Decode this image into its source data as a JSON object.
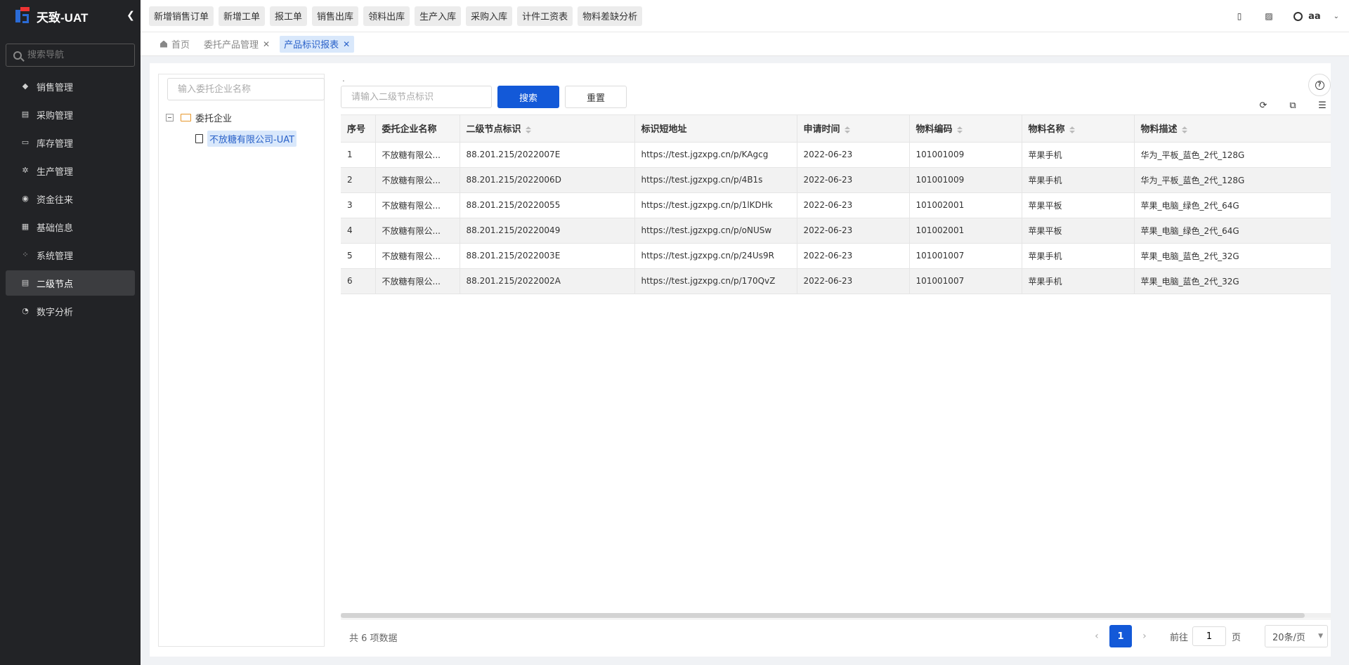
{
  "app": {
    "title": "天致-UAT",
    "collapse_icon": "chevron-left-icon"
  },
  "sidebar": {
    "search_placeholder": "搜索导航",
    "items": [
      {
        "label": "销售管理",
        "icon": "tag-icon",
        "active": false
      },
      {
        "label": "采购管理",
        "icon": "cart-icon",
        "active": false
      },
      {
        "label": "库存管理",
        "icon": "warehouse-icon",
        "active": false
      },
      {
        "label": "生产管理",
        "icon": "production-icon",
        "active": false
      },
      {
        "label": "资金往来",
        "icon": "money-icon",
        "active": false
      },
      {
        "label": "基础信息",
        "icon": "info-grid-icon",
        "active": false
      },
      {
        "label": "系统管理",
        "icon": "apps-icon",
        "active": false
      },
      {
        "label": "二级节点",
        "icon": "node-doc-icon",
        "active": true
      },
      {
        "label": "数字分析",
        "icon": "pie-chart-icon",
        "active": false
      }
    ]
  },
  "topbar": {
    "quick_buttons": [
      "新增销售订单",
      "新增工单",
      "报工单",
      "销售出库",
      "领料出库",
      "生产入库",
      "采购入库",
      "计件工资表",
      "物料差缺分析"
    ],
    "user_name": "aa"
  },
  "tabs": [
    {
      "label": "首页",
      "closable": false,
      "active": false
    },
    {
      "label": "委托产品管理",
      "closable": true,
      "active": false
    },
    {
      "label": "产品标识报表",
      "closable": true,
      "active": true
    }
  ],
  "tree": {
    "search_placeholder": "输入委托企业名称",
    "root_label": "委托企业",
    "child_label": "不放糖有限公司-UAT"
  },
  "filter": {
    "dot": ".",
    "search_placeholder": "请输入二级节点标识",
    "search_label": "搜索",
    "reset_label": "重置"
  },
  "table": {
    "columns": [
      "序号",
      "委托企业名称",
      "二级节点标识",
      "标识短地址",
      "申请时间",
      "物料编码",
      "物料名称",
      "物料描述"
    ],
    "rows": [
      [
        "1",
        "不放糖有限公...",
        "88.201.215/2022007E",
        "https://test.jgzxpg.cn/p/KAgcg",
        "2022-06-23",
        "101001009",
        "苹果手机",
        "华为_平板_蓝色_2代_128G"
      ],
      [
        "2",
        "不放糖有限公...",
        "88.201.215/2022006D",
        "https://test.jgzxpg.cn/p/4B1s",
        "2022-06-23",
        "101001009",
        "苹果手机",
        "华为_平板_蓝色_2代_128G"
      ],
      [
        "3",
        "不放糖有限公...",
        "88.201.215/20220055",
        "https://test.jgzxpg.cn/p/1lKDHk",
        "2022-06-23",
        "101002001",
        "苹果平板",
        "苹果_电脑_绿色_2代_64G"
      ],
      [
        "4",
        "不放糖有限公...",
        "88.201.215/20220049",
        "https://test.jgzxpg.cn/p/oNUSw",
        "2022-06-23",
        "101002001",
        "苹果平板",
        "苹果_电脑_绿色_2代_64G"
      ],
      [
        "5",
        "不放糖有限公...",
        "88.201.215/2022003E",
        "https://test.jgzxpg.cn/p/24Us9R",
        "2022-06-23",
        "101001007",
        "苹果手机",
        "苹果_电脑_蓝色_2代_32G"
      ],
      [
        "6",
        "不放糖有限公...",
        "88.201.215/2022002A",
        "https://test.jgzxpg.cn/p/170QvZ",
        "2022-06-23",
        "101001007",
        "苹果手机",
        "苹果_电脑_蓝色_2代_32G"
      ]
    ]
  },
  "pagination": {
    "total_text": "共 6 项数据",
    "current_page": "1",
    "goto_prefix": "前往",
    "goto_value": "1",
    "goto_suffix": "页",
    "page_size": "20条/页"
  }
}
